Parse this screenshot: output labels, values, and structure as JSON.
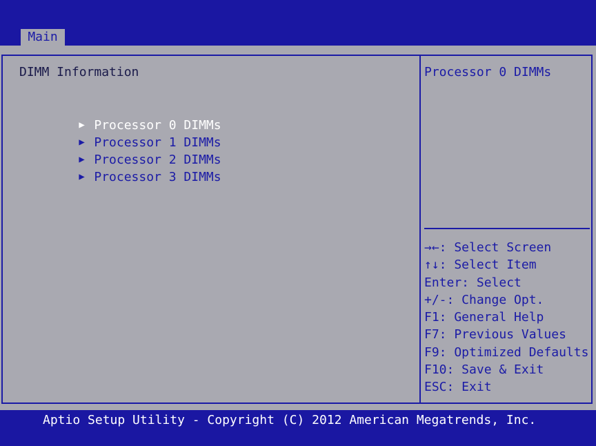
{
  "tabs": {
    "main_label": "Main"
  },
  "main": {
    "section_title": "DIMM Information",
    "items": [
      {
        "label": "Processor 0 DIMMs",
        "selected": true
      },
      {
        "label": "Processor 1 DIMMs",
        "selected": false
      },
      {
        "label": "Processor 2 DIMMs",
        "selected": false
      },
      {
        "label": "Processor 3 DIMMs",
        "selected": false
      }
    ],
    "arrow_glyph": "▶"
  },
  "help": {
    "text": "Processor 0 DIMMs"
  },
  "keys": [
    "→←: Select Screen",
    "↑↓: Select Item",
    "Enter: Select",
    "+/-: Change Opt.",
    "F1: General Help",
    "F7: Previous Values",
    "F9: Optimized Defaults",
    "F10: Save & Exit",
    "ESC: Exit"
  ],
  "footer": {
    "text": "Aptio Setup Utility - Copyright (C) 2012 American Megatrends, Inc."
  },
  "colors": {
    "background_blue": "#1a17a2",
    "panel_gray": "#a9a9b1",
    "text_blue": "#1b1ba6",
    "selected_white": "#ffffff"
  }
}
